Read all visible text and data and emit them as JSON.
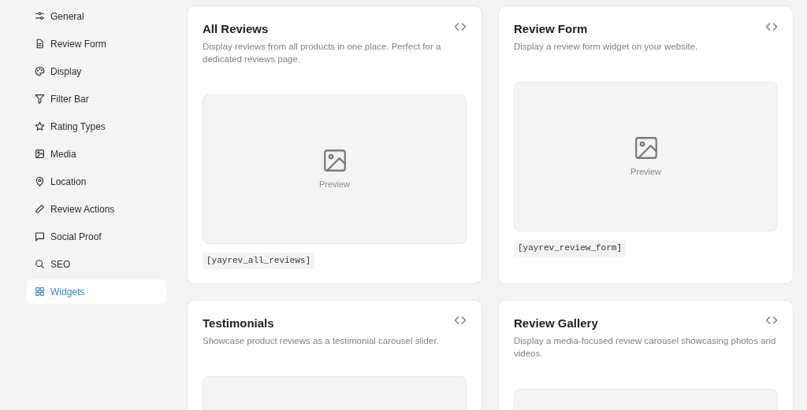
{
  "sidebar": {
    "items": [
      {
        "label": "General",
        "selected": false
      },
      {
        "label": "Review Form",
        "selected": false
      },
      {
        "label": "Display",
        "selected": false
      },
      {
        "label": "Filter Bar",
        "selected": false
      },
      {
        "label": "Rating Types",
        "selected": false
      },
      {
        "label": "Media",
        "selected": false
      },
      {
        "label": "Location",
        "selected": false
      },
      {
        "label": "Review Actions",
        "selected": false
      },
      {
        "label": "Social Proof",
        "selected": false
      },
      {
        "label": "SEO",
        "selected": false
      },
      {
        "label": "Widgets",
        "selected": true
      }
    ]
  },
  "widgets": [
    {
      "title": "All Reviews",
      "description": "Display reviews from all products in one place. Perfect for a dedicated reviews page.",
      "preview_label": "Preview",
      "shortcode": "[yayrev_all_reviews]"
    },
    {
      "title": "Review Form",
      "description": "Display a review form widget on your website.",
      "preview_label": "Preview",
      "shortcode": "[yayrev_review_form]"
    },
    {
      "title": "Testimonials",
      "description": "Showcase product reviews as a testimonial carousel slider."
    },
    {
      "title": "Review Gallery",
      "description": "Display a media-focused review carousel showcasing photos and videos."
    }
  ]
}
